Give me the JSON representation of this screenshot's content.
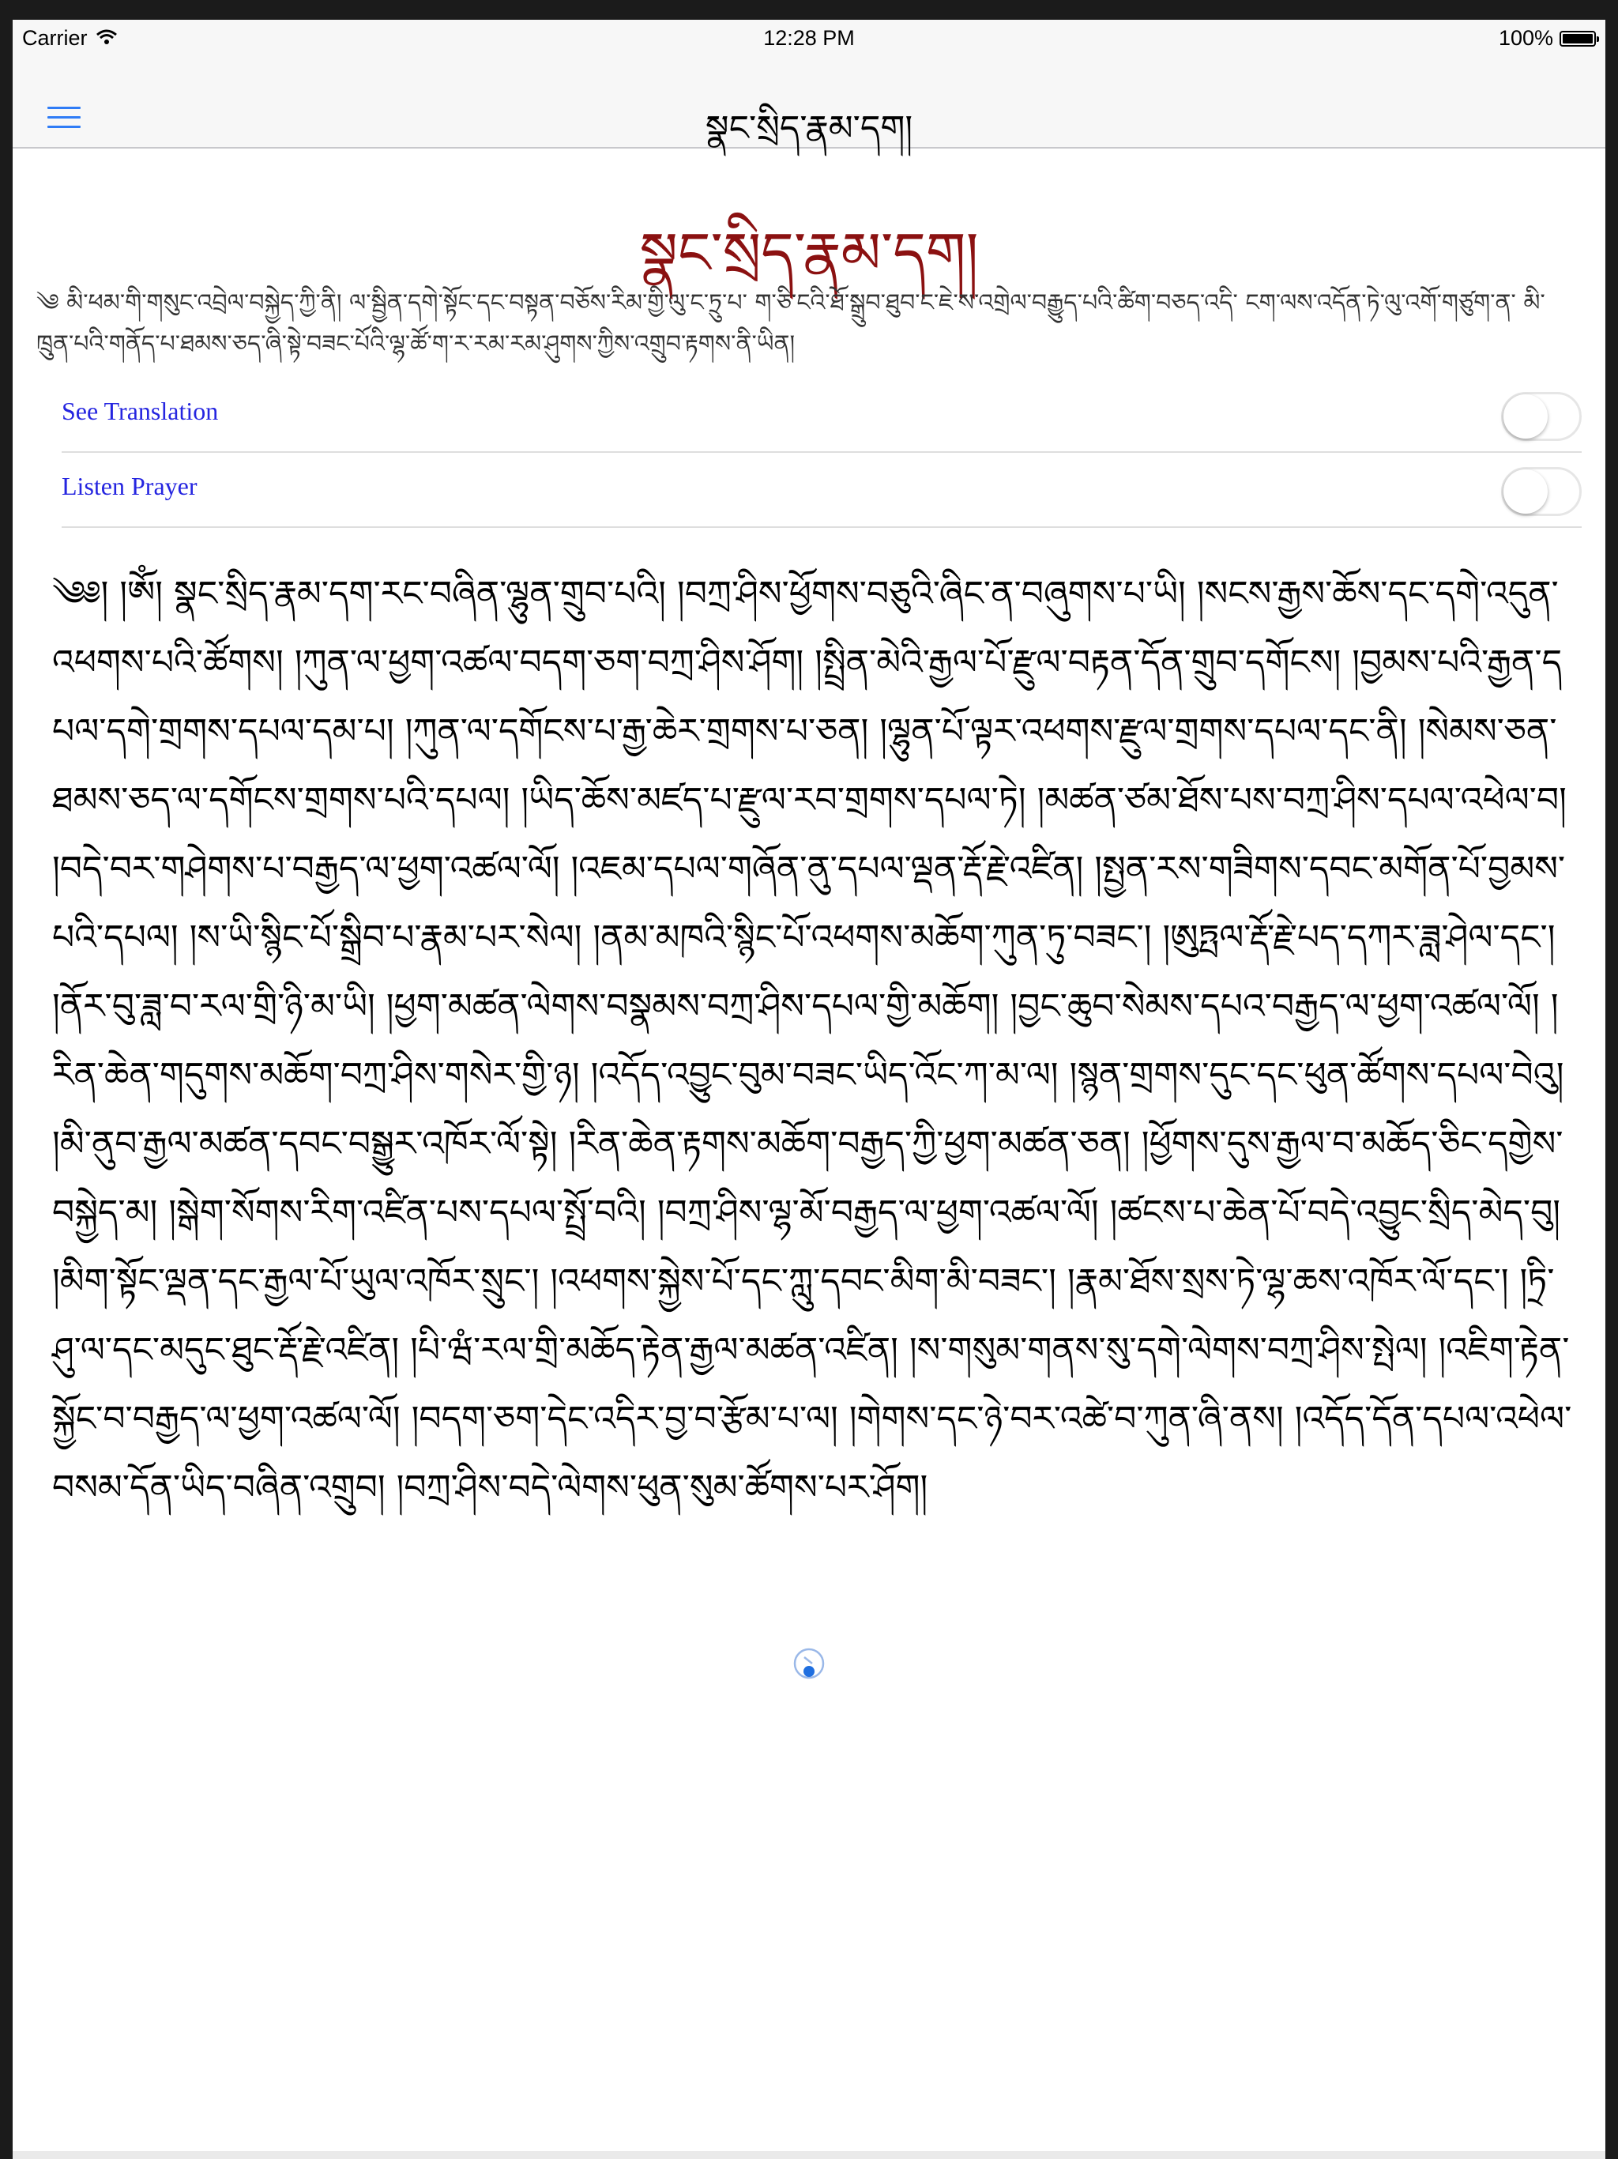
{
  "status_bar": {
    "carrier": "Carrier",
    "time": "12:28 PM",
    "battery": "100%"
  },
  "nav": {
    "menu_icon": "hamburger-icon",
    "title": "སྣང་སྲིད་རྣམ་དག།"
  },
  "page": {
    "title": "སྣང་སྲིད་རྣམ་དག།",
    "intro": "༄ མི་ཕམ་གི་གསུང་འབྲེལ་བསྐྱེད་ཀྱི་ནི། ལ་སྦྱིན་དགེ་སྟོང་དང་བསྟན་བཅོས་རིམ་གྱི་ལུ་ང་ཏྲུ་པ་ ག་ཅི་ངའི་ཐོ་སྒྲུབ་ཐུབ་ང་ཇེ་ས་འགྲེལ་བརྒྱུད་པའི་ཚིག་བཅད་འདི་ ངག་ལས་འདོན་ཏེ་ལུ་འགོ་གཙུག་ན་ མི་ཁྲུན་པའི་གནོད་པ་ཐམས་ཅད་ཞི་སྟེ་བཟང་པོའི་ལྷ་ཚོ་ག་ར་རམ་རམ་ཤུགས་ཀྱིས་འགྲུབ་རྟགས་ནི་ཡིན།",
    "settings": [
      {
        "label": "See Translation",
        "on": false
      },
      {
        "label": "Listen Prayer",
        "on": false
      }
    ],
    "prayer": "༄༅། །ཨོཾ། སྣང་སྲིད་རྣམ་དག་རང་བཞིན་ལྷུན་གྲུབ་པའི། །བཀྲ་ཤིས་ཕྱོགས་བཅུའི་ཞིང་ན་བཞུགས་པ་ཡི། །སངས་རྒྱས་ཆོས་དང་དགེ་འདུན་འཕགས་པའི་ཚོགས། །ཀུན་ལ་ཕྱག་འཚལ་བདག་ཅག་བཀྲ་ཤིས་ཤོག། །སྤྲིན་མེའི་རྒྱལ་པོ་རྫུལ་བརྟན་དོན་གྲུབ་དགོངས། །བྱམས་པའི་རྒྱན་དཔལ་དགེ་གྲགས་དཔལ་དམ་པ། །ཀུན་ལ་དགོངས་པ་རྒྱ་ཆེར་གྲགས་པ་ཅན། །ལྷུན་པོ་ལྟར་འཕགས་རྫུལ་གྲགས་དཔལ་དང་ནི། །སེམས་ཅན་ཐམས་ཅད་ལ་དགོངས་གྲགས་པའི་དཔལ། །ཡིད་ཆོས་མཛད་པ་རྫུལ་རབ་གྲགས་དཔལ་ཏེ། །མཚན་ཙམ་ཐོས་པས་བཀྲ་ཤིས་དཔལ་འཕེལ་བ། །བདེ་བར་གཤེགས་པ་བརྒྱད་ལ་ཕྱག་འཚལ་ལོ། །འཇམ་དཔལ་གཞོན་ནུ་དཔལ་ལྡན་རྡོ་རྗེ་འཛིན། །སྤྱན་རས་གཟིགས་དབང་མགོན་པོ་བྱམས་པའི་དཔལ། །ས་ཡི་སྙིང་པོ་སྒྲིབ་པ་རྣམ་པར་སེལ། །ནམ་མཁའི་སྙིང་པོ་འཕགས་མཆོག་ཀུན་ཏུ་བཟང་། །ཨུཏྤལ་རྡོ་རྗེ་པད་དཀར་ཟླ་ཤེལ་དང་། །ནོར་བུ་ཟླ་བ་རལ་གྲི་ཉི་མ་ཡི། །ཕྱག་མཚན་ལེགས་བསྣམས་བཀྲ་ཤིས་དཔལ་གྱི་མཆོག། །བྱང་ཆུབ་སེམས་དཔའ་བརྒྱད་ལ་ཕྱག་འཚལ་ལོ། །རིན་ཆེན་གདུགས་མཆོག་བཀྲ་ཤིས་གསེར་གྱི་ཉ། །འདོད་འབྱུང་བུམ་བཟང་ཡིད་འོང་ཀ་མ་ལ། །སྙན་གྲགས་དུང་དང་ཕུན་ཚོགས་དཔལ་བེའུ། །མི་ནུབ་རྒྱལ་མཚན་དབང་བསྒྱུར་འཁོར་ལོ་སྟེ། །རིན་ཆེན་རྟགས་མཆོག་བརྒྱད་ཀྱི་ཕྱག་མཚན་ཅན། །ཕྱོགས་དུས་རྒྱལ་བ་མཆོད་ཅིང་དགྱེས་བསྐྱེད་མ། །སྒེག་སོགས་རིག་འཛིན་པས་དཔལ་སྤྲོ་བའི། །བཀྲ་ཤིས་ལྷ་མོ་བརྒྱད་ལ་ཕྱག་འཚལ་ལོ། །ཚངས་པ་ཆེན་པོ་བདེ་འབྱུང་སྲིད་མེད་བུ། །མིག་སྟོང་ལྡན་དང་རྒྱལ་པོ་ཡུལ་འཁོར་སྲུང་། །འཕགས་སྐྱེས་པོ་དང་ཀླུ་དབང་མིག་མི་བཟང་། །རྣམ་ཐོས་སྲས་ཏེ་ལྷ་ཆས་འཁོར་ལོ་དང་། །ཏྲི་ཤུ་ལ་དང་མདུང་ཐུང་རྡོ་རྗེ་འཛིན། །པི་ཝཾ་རལ་གྲི་མཆོད་རྟེན་རྒྱལ་མཚན་འཛིན། །ས་གསུམ་གནས་སུ་དགེ་ལེགས་བཀྲ་ཤིས་སྤེལ། །འཇིག་རྟེན་སྐྱོང་བ་བརྒྱད་ལ་ཕྱག་འཚལ་ལོ། །བདག་ཅག་དེང་འདིར་བྱ་བ་རྩོམ་པ་ལ། །གེགས་དང་ཉེ་བར་འཚེ་བ་ཀུན་ཞི་ནས། །འདོད་དོན་དཔལ་འཕེལ་བསམ་དོན་ཡིད་བཞིན་འགྲུབ། །བཀྲ་ཤིས་བདེ་ལེགས་ཕུན་སུམ་ཚོགས་པར་ཤོག།",
    "audio_icon": "spinner-icon"
  },
  "colors": {
    "title": "#8b1111",
    "link": "#2525e0",
    "accent": "#2f7cf6"
  }
}
